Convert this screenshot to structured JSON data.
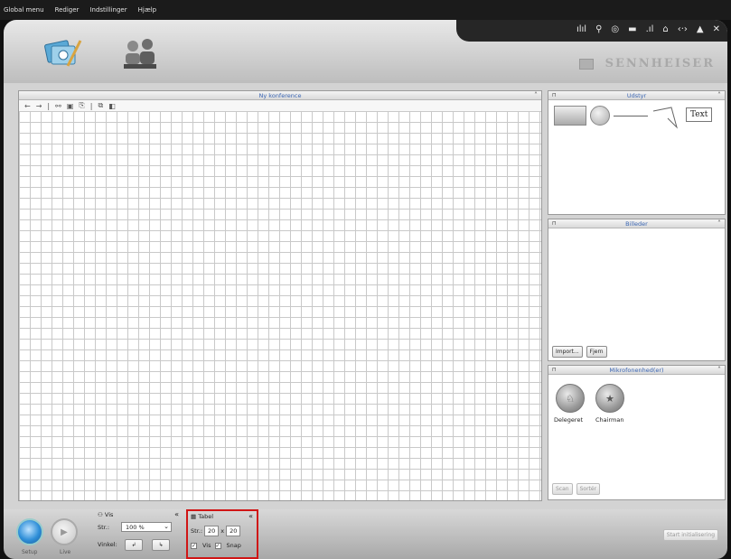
{
  "menu": [
    "Global menu",
    "Rediger",
    "Indstillinger",
    "Hjælp"
  ],
  "header": {
    "brand": "SENNHEISER",
    "tray_icons": [
      "signal-icon",
      "zoom-icon",
      "sound-icon",
      "battery-icon",
      "bars-icon",
      "lock-icon",
      "arrows-icon",
      "warning-icon",
      "close-icon"
    ]
  },
  "canvas_panel": {
    "title": "Ny konference",
    "collapse": "˄",
    "tools": [
      "←",
      "→",
      "|",
      "⚯",
      "▣",
      "⎘",
      "|",
      "⧉",
      "◧"
    ]
  },
  "equipment_panel": {
    "title": "Udstyr",
    "collapse": "˄",
    "text_tool": "Text"
  },
  "images_panel": {
    "title": "Billeder",
    "collapse": "˄",
    "import_label": "Import...",
    "remove_label": "Fjern"
  },
  "mic_panel": {
    "title": "Mikrofonenhed(er)",
    "collapse": "˄",
    "delegate_label": "Delegeret",
    "chairman_label": "Chairman",
    "scan_label": "Scan",
    "sort_label": "Sortér"
  },
  "bottom": {
    "setup_label": "Setup",
    "live_label": "Live",
    "view_panel": {
      "title": "Vis",
      "size_label": "Str.:",
      "size_value": "100 %",
      "angle_label": "Vinkel:",
      "collapse": "«"
    },
    "table_panel": {
      "title": "Tabel",
      "size_label": "Str.:",
      "width": "20",
      "times": "x",
      "height": "20",
      "show_label": "Vis",
      "snap_label": "Snap",
      "collapse": "«"
    },
    "start_label": "Start initialisering"
  },
  "colors": {
    "accent_blue": "#3b66b3",
    "highlight_red": "#d01515"
  }
}
